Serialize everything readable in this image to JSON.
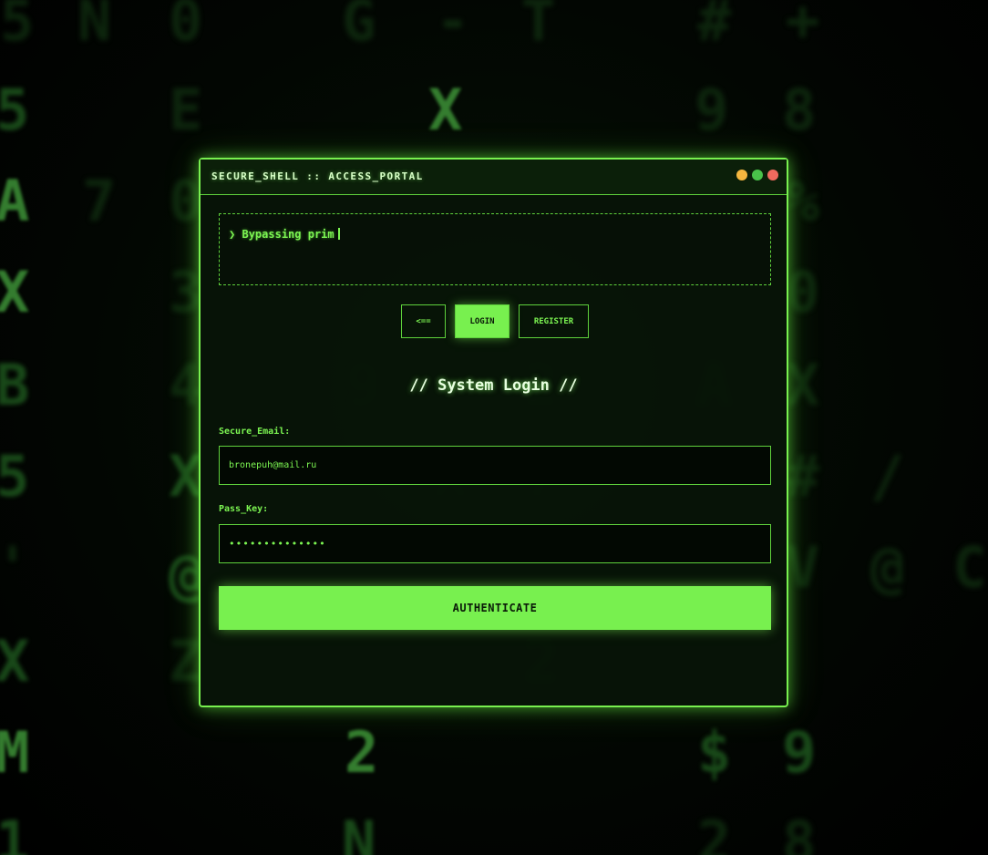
{
  "window": {
    "title": "SECURE_SHELL :: ACCESS_PORTAL",
    "controls": [
      "minimize",
      "maximize",
      "close"
    ]
  },
  "terminal": {
    "prompt": "❯",
    "text": "Bypassing prim"
  },
  "tabs": {
    "back_label": "<==",
    "login_label": "LOGIN",
    "register_label": "REGISTER",
    "active": "LOGIN"
  },
  "form": {
    "title": "// System Login //",
    "email_label": "Secure_Email:",
    "email_value": "bronepuh@mail.ru",
    "pass_label": "Pass_Key:",
    "pass_value": "••••••••••••••",
    "submit_label": "AUTHENTICATE"
  },
  "background_glyphs": [
    "5",
    "N",
    "0",
    "G",
    "-",
    "T",
    "#",
    "+",
    "5",
    "E",
    "X",
    "9",
    "8",
    "A",
    "7",
    "0",
    "%",
    "X",
    "3",
    "0",
    "B",
    "4",
    "9",
    "2",
    "A",
    "X",
    "5",
    "X",
    "X",
    "7",
    "#",
    "/",
    "'",
    "@",
    "V",
    "@",
    "C",
    "X",
    "Z",
    "2",
    "M",
    "2",
    "$",
    "9",
    "1",
    "N",
    "2",
    "8"
  ],
  "colors": {
    "accent": "#78f04f",
    "text": "#7cf552",
    "background": "#000000",
    "dot_yellow": "#f4b63f",
    "dot_green": "#49c24a",
    "dot_red": "#ef6a5e"
  }
}
